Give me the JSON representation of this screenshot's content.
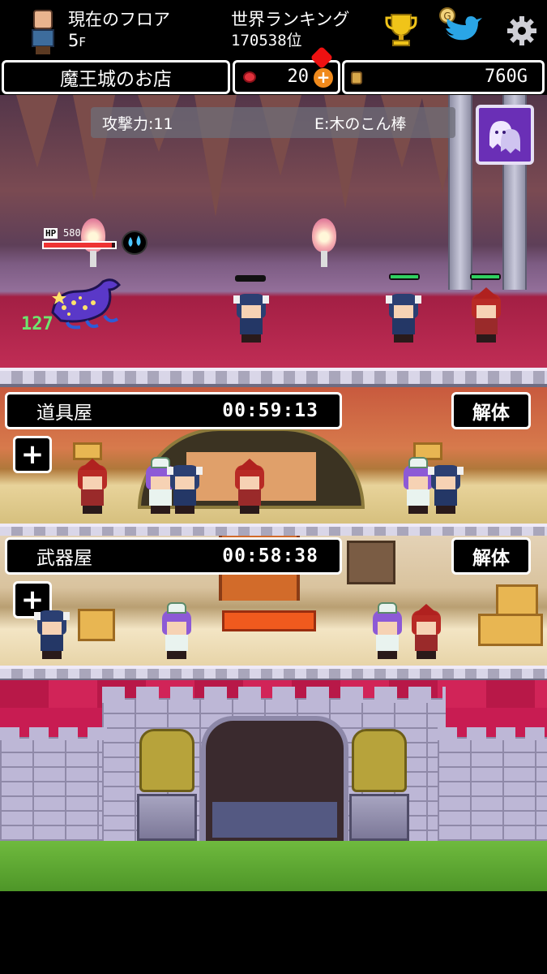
{
  "header": {
    "floor_label": "現在のフロア",
    "floor_value": "5",
    "floor_unit": "F",
    "ranking_label": "世界ランキング",
    "ranking_value": "170538位"
  },
  "icons": {
    "trophy": "trophy-icon",
    "twitter": "twitter-bird-icon",
    "settings": "gear-icon",
    "gem": "red-gem-icon",
    "gem_add": "orange-plus-icon",
    "gold": "gold-coin-icon",
    "skill": "ghost-skill-icon"
  },
  "resources": {
    "shop_title": "魔王城のお店",
    "gems": "20",
    "gold": "760G"
  },
  "battle": {
    "attack_label": "攻撃力:11",
    "equip_label": "E:木のこん棒",
    "enemy_hp_label": "HP",
    "enemy_hp_value": "580",
    "enemy_hp_fraction": 0.95,
    "damage_popup": "127"
  },
  "shops": [
    {
      "name": "道具屋",
      "timer": "00:59:13",
      "dismantle": "解体",
      "add": "+"
    },
    {
      "name": "武器屋",
      "timer": "00:58:38",
      "dismantle": "解体",
      "add": "+"
    }
  ],
  "colors": {
    "accent_orange": "#f08a1c",
    "hp_red": "#e33333",
    "ally_hp_green": "#2fd060",
    "skill_purple": "#6a2fb6",
    "castle_red": "#c81c52"
  }
}
